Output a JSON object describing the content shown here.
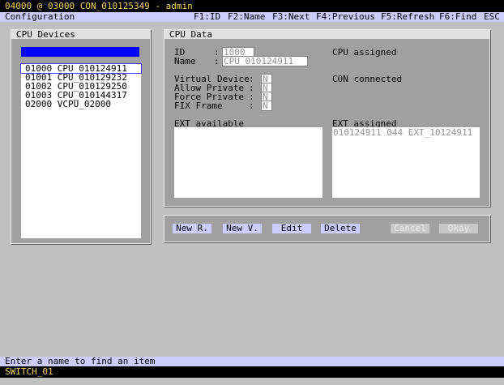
{
  "title_bar": "04000 @ 03000 CON_010125349 - admin",
  "menu": {
    "section": "Configuration",
    "keys": [
      "F1:ID",
      "F2:Name",
      "F3:Next",
      "F4:Previous",
      "F5:Refresh",
      "F6:Find",
      "ESC"
    ]
  },
  "cpu_devices": {
    "title": "CPU Devices",
    "search_value": "",
    "items": [
      {
        "id": "01000",
        "name": "CPU_010124911"
      },
      {
        "id": "01001",
        "name": "CPU_010129232"
      },
      {
        "id": "01002",
        "name": "CPU_010129250"
      },
      {
        "id": "01003",
        "name": "CPU_010144317"
      },
      {
        "id": "02000",
        "name": "VCPU_02000"
      }
    ]
  },
  "cpu_data": {
    "title": "CPU Data",
    "id_label": "ID",
    "id_value": "1000",
    "name_label": "Name",
    "name_value": "CPU_010124911",
    "colon": ":",
    "virtual_device_label": "Virtual Device",
    "virtual_device_value": "N",
    "allow_private_label": "Allow Private",
    "allow_private_value": "N",
    "force_private_label": "Force Private",
    "force_private_value": "N",
    "fix_frame_label": "FIX Frame",
    "fix_frame_value": "N",
    "cpu_assigned_label": "CPU assigned",
    "con_connected_label": "CON connected",
    "ext_available_label": "EXT available",
    "ext_available_items": [],
    "ext_assigned_label": "EXT assigned",
    "ext_assigned_items": [
      "010124911 044 EXT_10124911"
    ]
  },
  "buttons": {
    "new_r": "New R.",
    "new_v": "New V.",
    "edit": "Edit",
    "delete": "Delete",
    "cancel": "Cancel",
    "okay": "Okay"
  },
  "status_hint": "Enter a name to find an item",
  "footer": "SWITCH_01",
  "colors": {
    "title_bg": "#000000",
    "title_fg": "#f5d25a",
    "menu_bg": "#ccccff",
    "panel_bg": "#a0a0a0",
    "search_bar": "#0000ff",
    "button_bg": "#ccccff"
  }
}
